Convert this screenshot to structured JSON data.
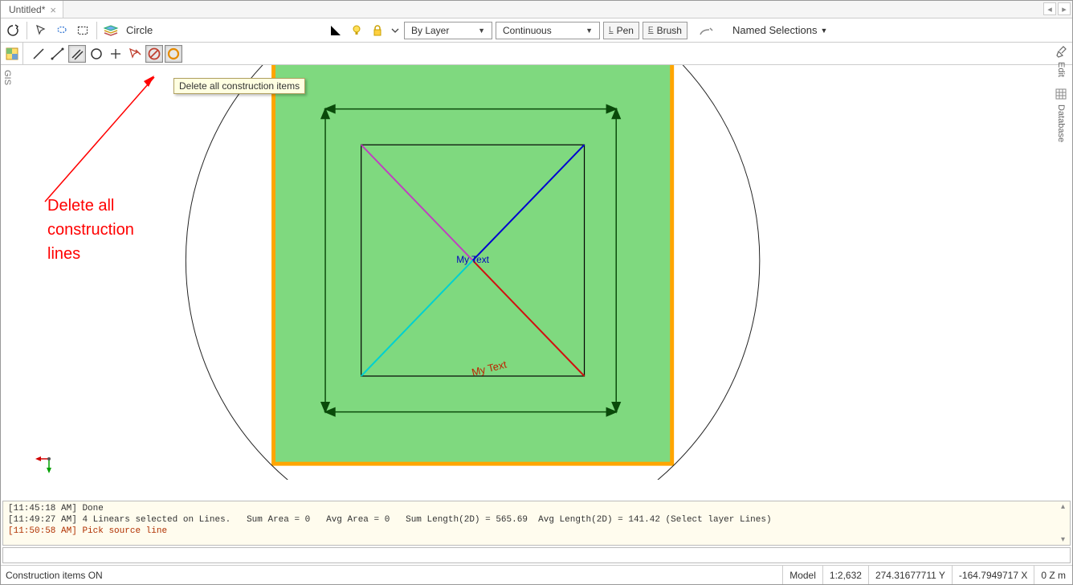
{
  "tab": {
    "title": "Untitled*"
  },
  "toolbar": {
    "current_tool": "Circle",
    "layer": "By Layer",
    "linetype": "Continuous",
    "pen_label": "Pen",
    "pen_key": "L",
    "brush_label": "Brush",
    "brush_key": "E",
    "named_selections": "Named Selections"
  },
  "tooltip": {
    "delete_all": "Delete all construction items"
  },
  "annotation": {
    "text": "Delete all\nconstruction\nlines"
  },
  "canvas": {
    "text_center": "My Text",
    "text_diagonal": "My Text"
  },
  "log": {
    "lines": [
      {
        "ts": "[11:45:18 AM]",
        "msg": "Done",
        "cls": ""
      },
      {
        "ts": "[11:49:27 AM]",
        "msg": "4 Linears selected on Lines.   Sum Area = 0   Avg Area = 0   Sum Length(2D) = 565.69  Avg Length(2D) = 141.42 (Select layer Lines)",
        "cls": ""
      },
      {
        "ts": "[11:50:58 AM]",
        "msg": "Pick source line",
        "cls": "red"
      }
    ]
  },
  "status": {
    "left": "Construction items ON",
    "model": "Model",
    "scale": "1:2,632",
    "y": "274.31677711 Y",
    "x": "-164.7949717 X",
    "z": "0 Z m"
  },
  "sidebar": {
    "left": "GIS",
    "right_edit": "Edit",
    "right_db": "Database"
  }
}
